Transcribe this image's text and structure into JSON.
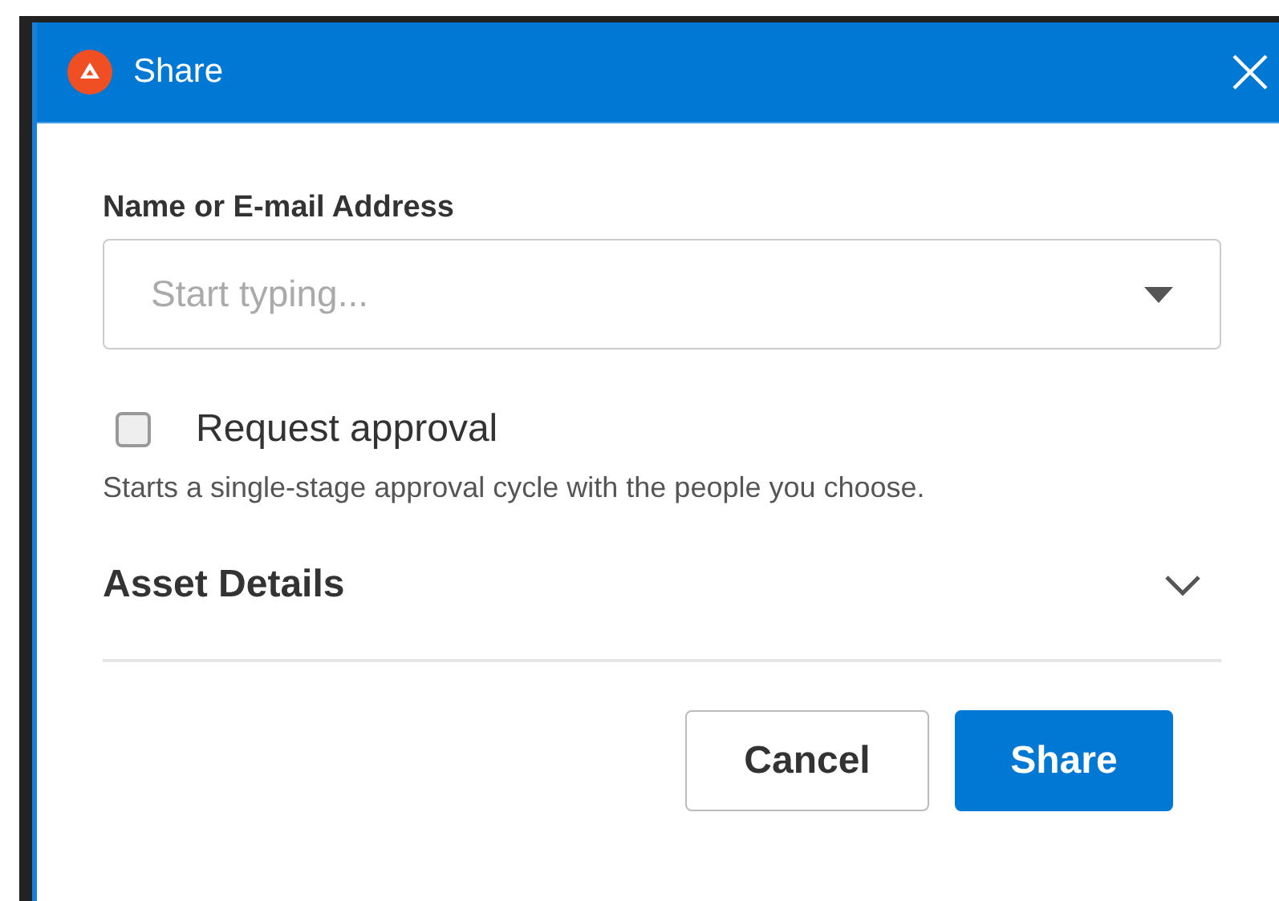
{
  "dialog": {
    "title": "Share"
  },
  "recipient_field": {
    "label": "Name or E-mail Address",
    "placeholder": "Start typing..."
  },
  "request_approval": {
    "label": "Request approval",
    "checked": false,
    "hint": "Starts a single-stage approval cycle with the people you choose."
  },
  "asset_details": {
    "label": "Asset Details",
    "expanded": false
  },
  "buttons": [
    {
      "label": "Cancel",
      "kind": "secondary"
    },
    {
      "label": "Share",
      "kind": "primary"
    }
  ]
}
